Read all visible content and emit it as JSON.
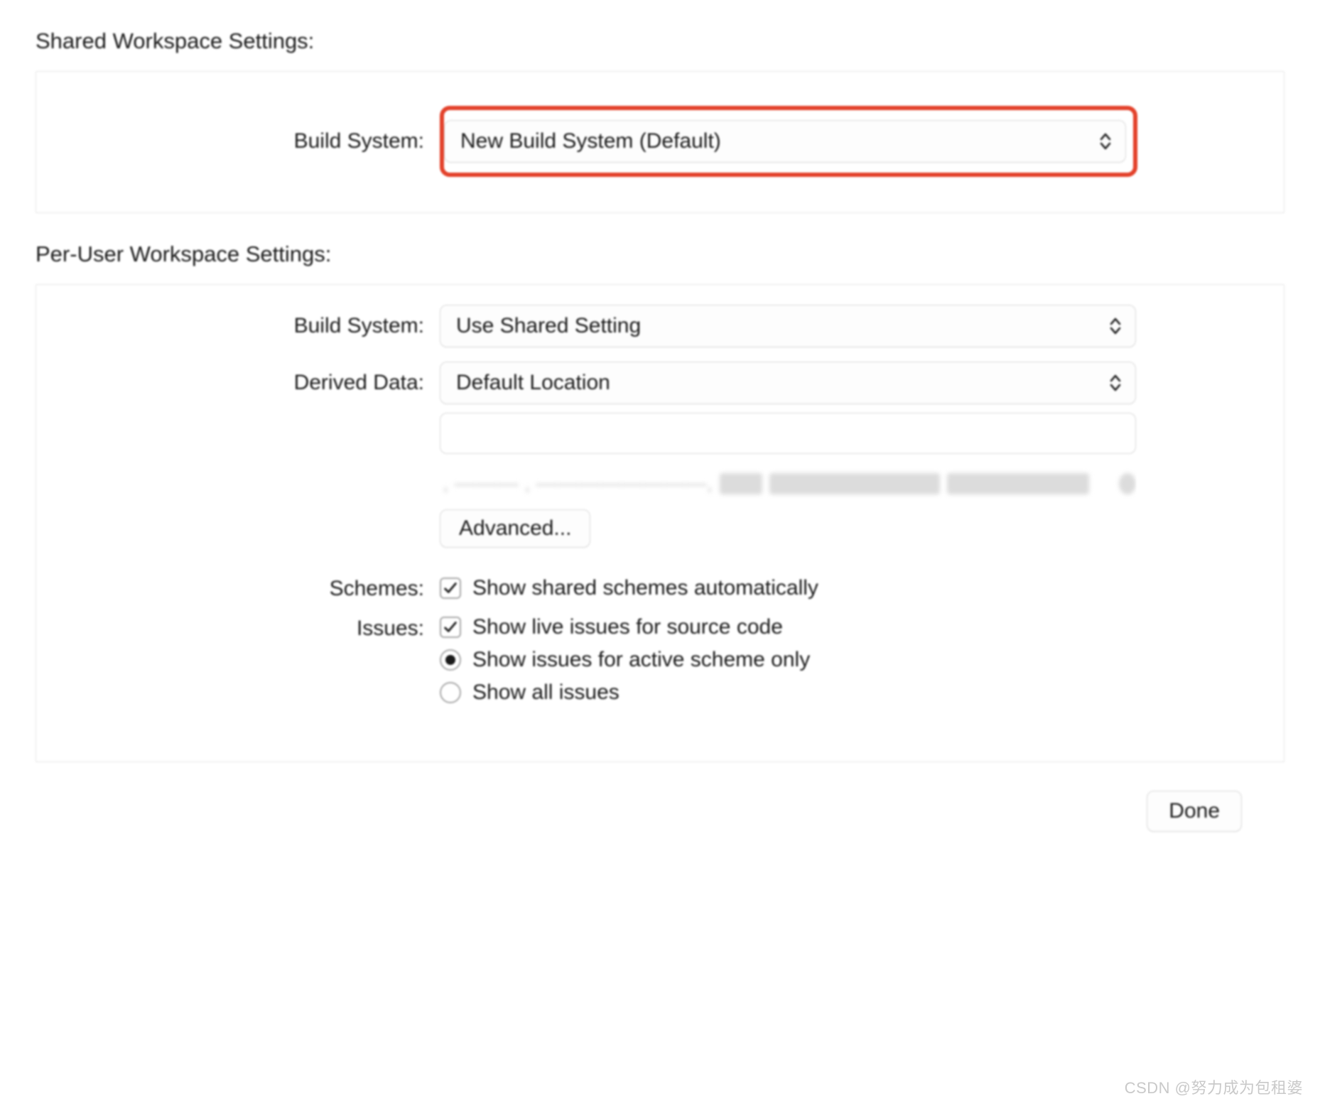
{
  "shared": {
    "title": "Shared Workspace Settings:",
    "build_system": {
      "label": "Build System:",
      "value": "New Build System (Default)"
    }
  },
  "per_user": {
    "title": "Per-User Workspace Settings:",
    "build_system": {
      "label": "Build System:",
      "value": "Use Shared Setting"
    },
    "derived_data": {
      "label": "Derived Data:",
      "value": "Default Location"
    },
    "path_value": "",
    "advanced_button": "Advanced...",
    "schemes": {
      "label": "Schemes:",
      "show_shared": "Show shared schemes automatically"
    },
    "issues": {
      "label": "Issues:",
      "live": "Show live issues for source code",
      "active_only": "Show issues for active scheme only",
      "show_all": "Show all issues"
    }
  },
  "done_button": "Done",
  "watermark": "CSDN @努力成为包租婆"
}
